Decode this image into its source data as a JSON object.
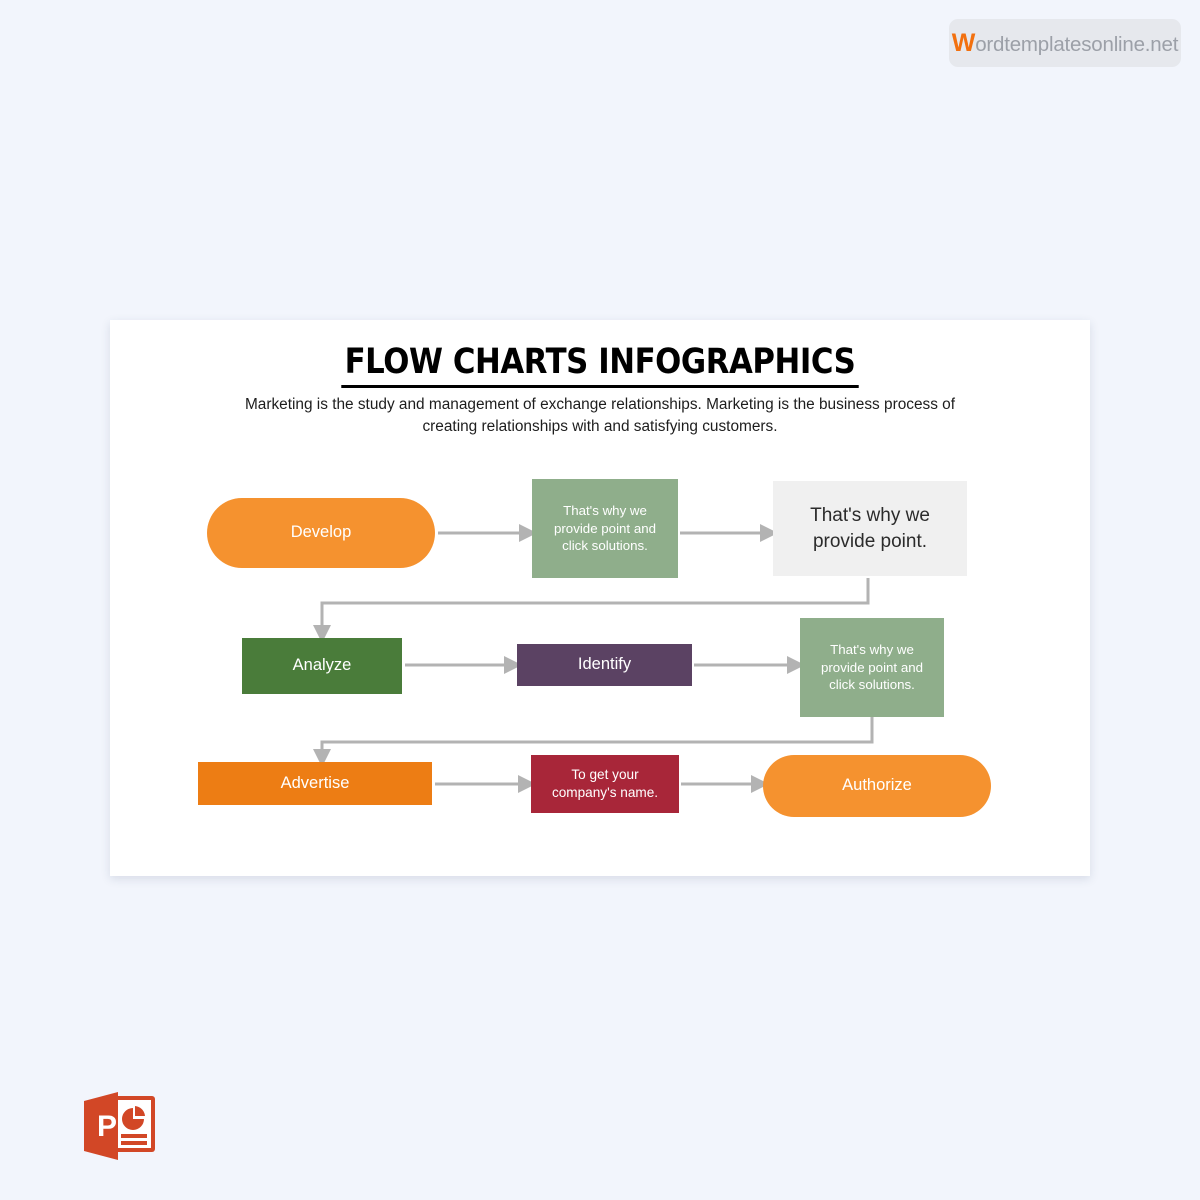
{
  "watermark": {
    "initial": "W",
    "text": "ordtemplatesonline.net",
    "brand_color": "#f2700f"
  },
  "slide": {
    "title": "FLOW CHARTS INFOGRAPHICS",
    "subtitle": "Marketing is the study and management of exchange relationships. Marketing is the business process of creating relationships with and satisfying customers."
  },
  "chart_data": {
    "type": "diagram",
    "title": "FLOW CHARTS INFOGRAPHICS",
    "nodes": [
      {
        "id": "develop",
        "label": "Develop",
        "shape": "pill",
        "color": "#f5922f",
        "text_color": "#ffffff",
        "row": 1,
        "col": 1
      },
      {
        "id": "green-1",
        "label": "That's why we provide point and click solutions.",
        "shape": "rectangle",
        "color": "#8fae8b",
        "text_color": "#ffffff",
        "row": 1,
        "col": 2
      },
      {
        "id": "gray-1",
        "label": "That's why we provide point.",
        "shape": "rectangle",
        "color": "#f0f0f0",
        "text_color": "#2b2b2b",
        "row": 1,
        "col": 3
      },
      {
        "id": "analyze",
        "label": "Analyze",
        "shape": "rectangle",
        "color": "#4a7c3a",
        "text_color": "#ffffff",
        "row": 2,
        "col": 1
      },
      {
        "id": "identify",
        "label": "Identify",
        "shape": "rectangle",
        "color": "#5b4263",
        "text_color": "#ffffff",
        "row": 2,
        "col": 2
      },
      {
        "id": "green-2",
        "label": "That's why we provide point and click solutions.",
        "shape": "rectangle",
        "color": "#8fae8b",
        "text_color": "#ffffff",
        "row": 2,
        "col": 3
      },
      {
        "id": "advertise",
        "label": "Advertise",
        "shape": "rectangle",
        "color": "#ed7d14",
        "text_color": "#ffffff",
        "row": 3,
        "col": 1
      },
      {
        "id": "redbox",
        "label": "To get your company's name.",
        "shape": "rectangle",
        "color": "#a82639",
        "text_color": "#ffffff",
        "row": 3,
        "col": 2
      },
      {
        "id": "authorize",
        "label": "Authorize",
        "shape": "pill",
        "color": "#f5922f",
        "text_color": "#ffffff",
        "row": 3,
        "col": 3
      }
    ],
    "edges": [
      {
        "from": "develop",
        "to": "green-1",
        "style": "straight-right"
      },
      {
        "from": "green-1",
        "to": "gray-1",
        "style": "straight-right"
      },
      {
        "from": "gray-1",
        "to": "analyze",
        "style": "down-left-down"
      },
      {
        "from": "analyze",
        "to": "identify",
        "style": "straight-right"
      },
      {
        "from": "identify",
        "to": "green-2",
        "style": "straight-right"
      },
      {
        "from": "green-2",
        "to": "advertise",
        "style": "down-left-down"
      },
      {
        "from": "advertise",
        "to": "redbox",
        "style": "straight-right"
      },
      {
        "from": "redbox",
        "to": "authorize",
        "style": "straight-right"
      }
    ],
    "connector_color": "#b3b3b3"
  },
  "node_labels": {
    "develop": "Develop",
    "green_1": "That's why we provide point and click solutions.",
    "gray_1": "That's why we provide point.",
    "analyze": "Analyze",
    "identify": "Identify",
    "green_2": "That's why we provide point and click solutions.",
    "advertise": "Advertise",
    "redbox": "To get your company's name.",
    "authorize": "Authorize"
  },
  "footer": {
    "logo_name": "powerpoint-logo",
    "logo_letter": "P",
    "logo_color": "#d24726"
  }
}
